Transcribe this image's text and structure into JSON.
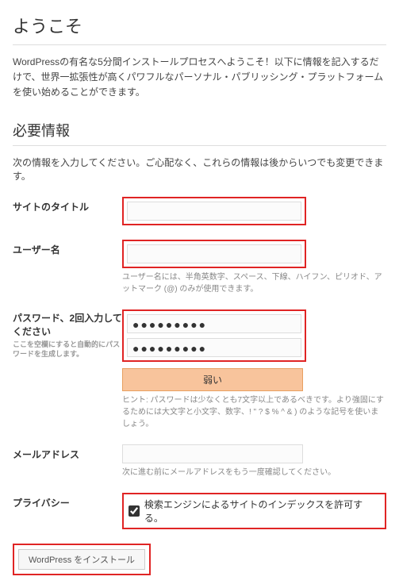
{
  "header": {
    "welcome": "ようこそ"
  },
  "intro": "WordPressの有名な5分間インストールプロセスへようこそ！以下に情報を記入するだけで、世界一拡張性が高くパワフルなパーソナル・パブリッシング・プラットフォームを使い始めることができます。",
  "section": {
    "title": "必要情報",
    "description": "次の情報を入力してください。ご心配なく、これらの情報は後からいつでも変更できます。"
  },
  "fields": {
    "site_title": {
      "label": "サイトのタイトル",
      "value": ""
    },
    "username": {
      "label": "ユーザー名",
      "value": "",
      "hint": "ユーザー名には、半角英数字、スペース、下線、ハイフン、ピリオド、アットマーク (@) のみが使用できます。"
    },
    "password": {
      "label": "パスワード、2回入力してください",
      "sub": "ここを空欄にすると自動的にパスワードを生成します。",
      "value1": "●●●●●●●●●",
      "value2": "●●●●●●●●●",
      "strength": "弱い",
      "hint": "ヒント: パスワードは少なくとも7文字以上であるべきです。より強固にするためには大文字と小文字、数字、! \" ? $ % ^ & ) のような記号を使いましょう。"
    },
    "email": {
      "label": "メールアドレス",
      "hint": "次に進む前にメールアドレスをもう一度確認してください。"
    },
    "privacy": {
      "label": "プライバシー",
      "checkbox_label": "検索エンジンによるサイトのインデックスを許可する。",
      "checked": true
    }
  },
  "install_button": "WordPress をインストール"
}
